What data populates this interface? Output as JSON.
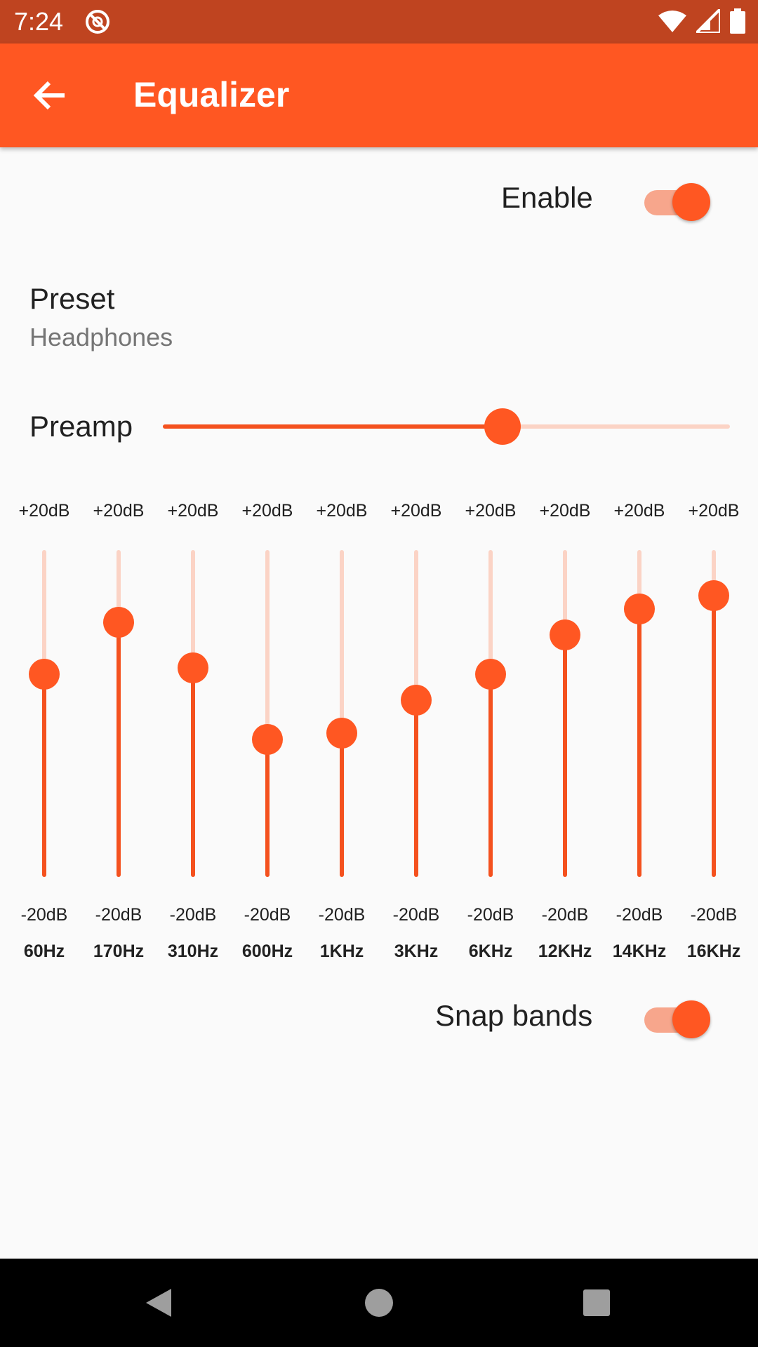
{
  "status_bar": {
    "time": "7:24"
  },
  "app_bar": {
    "title": "Equalizer"
  },
  "enable": {
    "label": "Enable",
    "checked": true
  },
  "preset": {
    "title": "Preset",
    "value": "Headphones"
  },
  "preamp": {
    "label": "Preamp",
    "level_fraction": 0.6
  },
  "bands": [
    {
      "max_label": "+20dB",
      "min_label": "-20dB",
      "freq": "60Hz",
      "level_fraction": 0.62
    },
    {
      "max_label": "+20dB",
      "min_label": "-20dB",
      "freq": "170Hz",
      "level_fraction": 0.78
    },
    {
      "max_label": "+20dB",
      "min_label": "-20dB",
      "freq": "310Hz",
      "level_fraction": 0.64
    },
    {
      "max_label": "+20dB",
      "min_label": "-20dB",
      "freq": "600Hz",
      "level_fraction": 0.42
    },
    {
      "max_label": "+20dB",
      "min_label": "-20dB",
      "freq": "1KHz",
      "level_fraction": 0.44
    },
    {
      "max_label": "+20dB",
      "min_label": "-20dB",
      "freq": "3KHz",
      "level_fraction": 0.54
    },
    {
      "max_label": "+20dB",
      "min_label": "-20dB",
      "freq": "6KHz",
      "level_fraction": 0.62
    },
    {
      "max_label": "+20dB",
      "min_label": "-20dB",
      "freq": "12KHz",
      "level_fraction": 0.74
    },
    {
      "max_label": "+20dB",
      "min_label": "-20dB",
      "freq": "14KHz",
      "level_fraction": 0.82
    },
    {
      "max_label": "+20dB",
      "min_label": "-20dB",
      "freq": "16KHz",
      "level_fraction": 0.86
    }
  ],
  "snap_bands": {
    "label": "Snap bands",
    "checked": true
  },
  "colors": {
    "accent": "#ff5722",
    "status_bar": "#bf4420",
    "track_inactive": "#fbd3c5",
    "switch_track": "#f7a68c"
  },
  "icons": {
    "back": "arrow-left-icon",
    "dnd": "do-not-disturb-icon",
    "wifi": "wifi-icon",
    "signal": "cell-signal-icon",
    "battery": "battery-icon",
    "nav_back": "triangle-back-icon",
    "nav_home": "circle-home-icon",
    "nav_recents": "square-recents-icon"
  }
}
